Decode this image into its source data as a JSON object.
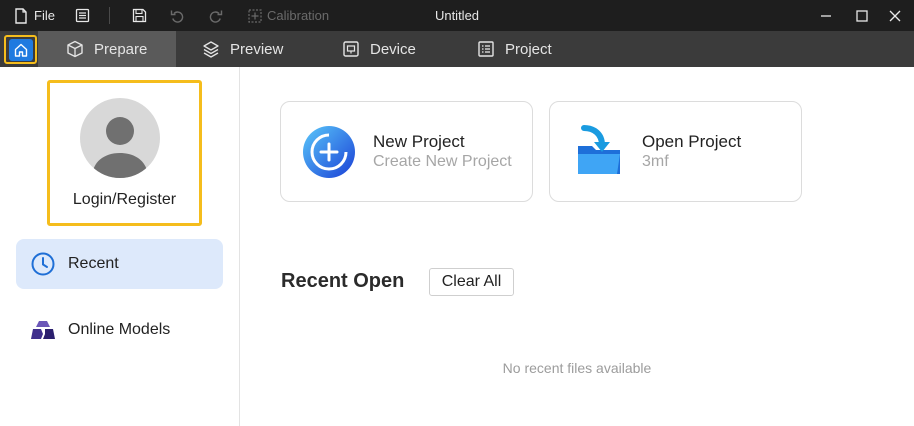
{
  "titlebar": {
    "file_label": "File",
    "calibration_label": "Calibration",
    "window_title": "Untitled"
  },
  "tabs": [
    {
      "label": "Prepare"
    },
    {
      "label": "Preview"
    },
    {
      "label": "Device"
    },
    {
      "label": "Project"
    }
  ],
  "sidebar": {
    "login_label": "Login/Register",
    "items": [
      {
        "label": "Recent"
      },
      {
        "label": "Online Models"
      }
    ]
  },
  "main": {
    "cards": [
      {
        "title": "New Project",
        "subtitle": "Create New Project"
      },
      {
        "title": "Open Project",
        "subtitle": "3mf"
      }
    ],
    "recent_title": "Recent Open",
    "clear_all_label": "Clear All",
    "empty_message": "No recent files available"
  },
  "colors": {
    "accent": "#1f7ae0",
    "highlight": "#f5bd1c",
    "titlebar_bg": "#1e1e1e",
    "tabbar_bg": "#3b3b3b"
  }
}
